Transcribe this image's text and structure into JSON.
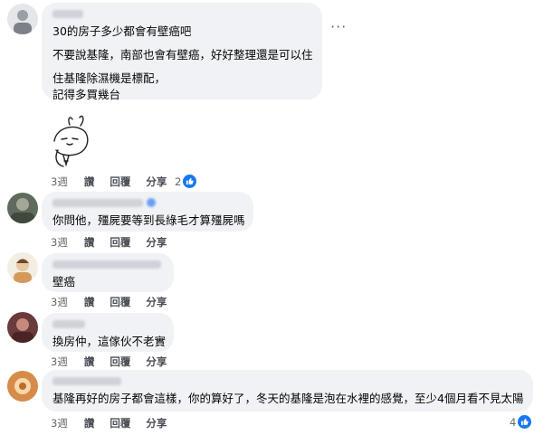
{
  "comments": [
    {
      "lines": [
        "30的房子多少都會有壁癌吧",
        "不要說基隆，南部也會有壁癌，好好整理還是可以住",
        "住基隆除濕機是標配，",
        "記得多買幾台"
      ],
      "actions": {
        "time": "3週",
        "like": "讚",
        "reply": "回覆",
        "share": "分享"
      },
      "reaction_count": "2",
      "more": "···"
    },
    {
      "lines": [
        "你問他，殭屍要等到長綠毛才算殭屍嗎"
      ],
      "actions": {
        "time": "3週",
        "like": "讚",
        "reply": "回覆",
        "share": "分享"
      }
    },
    {
      "lines": [
        "壁癌"
      ],
      "actions": {
        "time": "3週",
        "like": "讚",
        "reply": "回覆",
        "share": "分享"
      }
    },
    {
      "lines": [
        "換房仲，這傢伙不老實"
      ],
      "actions": {
        "time": "3週",
        "like": "讚",
        "reply": "回覆",
        "share": "分享"
      }
    },
    {
      "lines": [
        "基隆再好的房子都會這樣，你的算好了，冬天的基隆是泡在水裡的感覺，至少4個月看不見太陽"
      ],
      "actions": {
        "time": "3週",
        "like": "讚",
        "reply": "回覆",
        "share": "分享"
      },
      "reaction_count": "4"
    }
  ],
  "colors": {
    "bubble": "#f0f2f5",
    "like_blue": "#1877f2",
    "meta_text": "#65676b"
  },
  "icons": {
    "reaction": "thumbs-up-icon",
    "sticker": "rabbit-sticker"
  }
}
